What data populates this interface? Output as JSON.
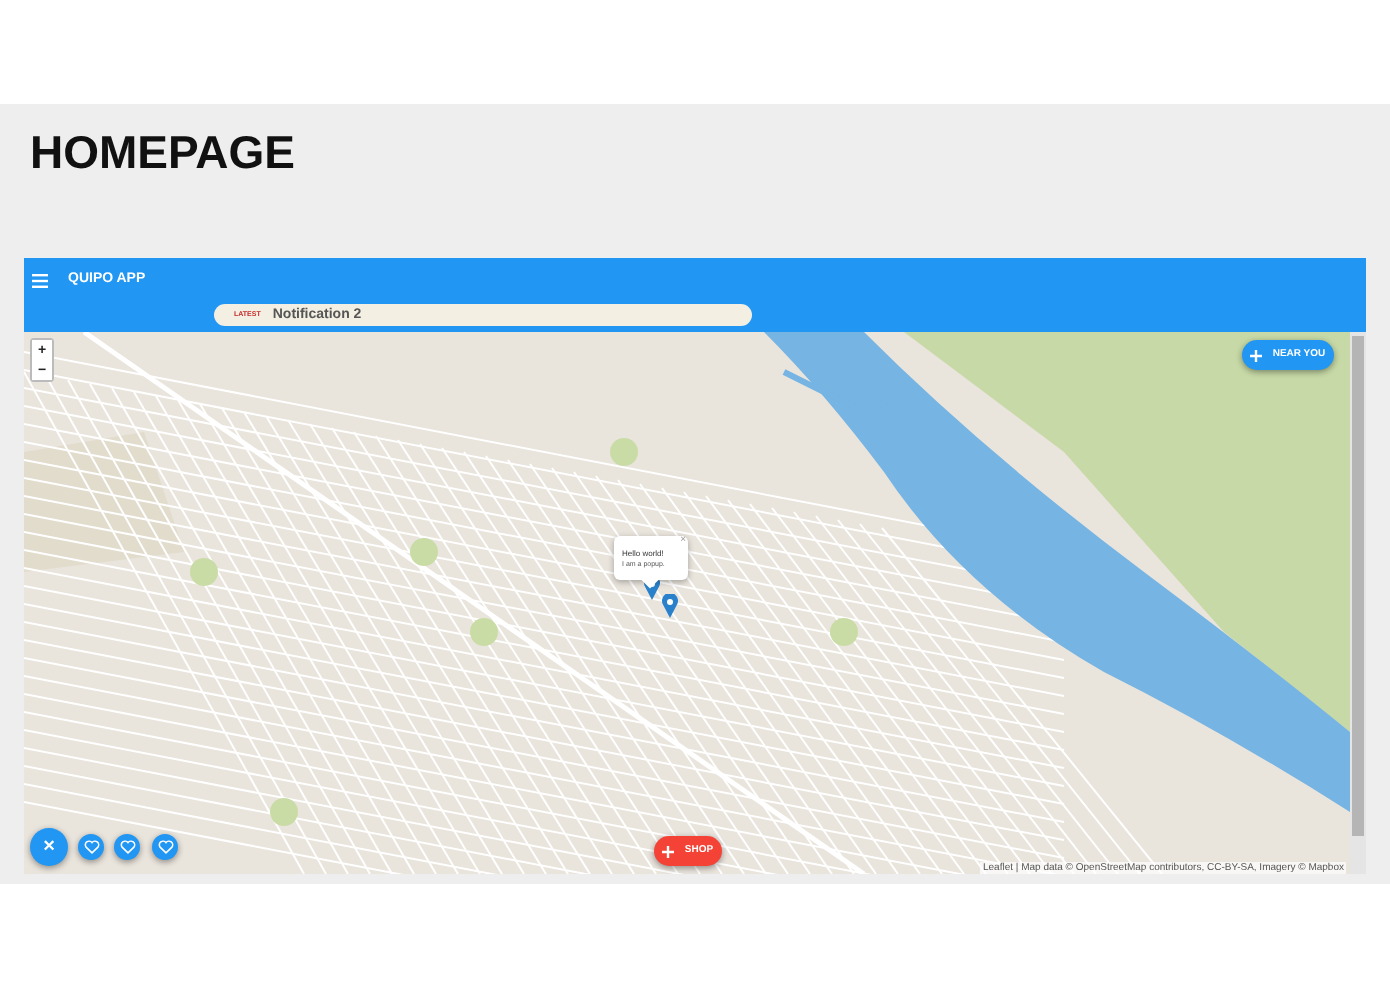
{
  "slide": {
    "title": "HOMEPAGE"
  },
  "app": {
    "title": "QUIPO APP",
    "notification": {
      "tag": "LATEST",
      "text": "Notification 2"
    }
  },
  "map": {
    "zoom_in": "+",
    "zoom_out": "−",
    "near_you_button": "NEAR YOU",
    "popup": {
      "title": "Hello world!",
      "text": "I am a popup.",
      "close": "×"
    },
    "close_button": "×",
    "shop_button": "SHOP",
    "attribution": "Leaflet | Map data © OpenStreetMap contributors, CC-BY-SA, Imagery © Mapbox"
  }
}
